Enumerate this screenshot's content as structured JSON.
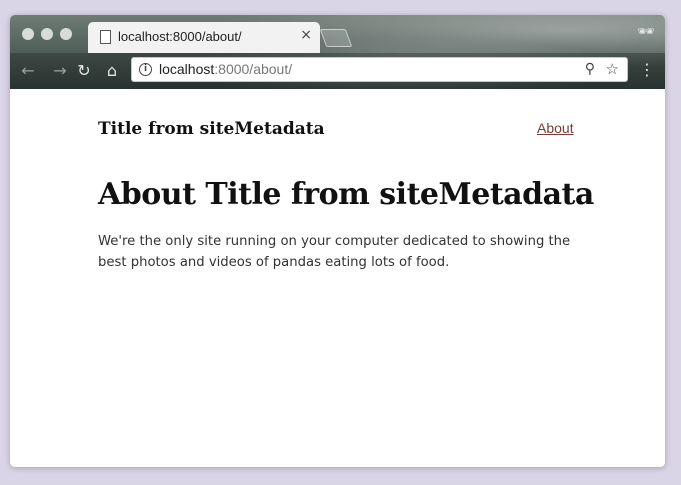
{
  "browser": {
    "tab": {
      "title": "localhost:8000/about/",
      "close_glyph": "×"
    },
    "address_bar": {
      "host": "localhost",
      "rest": ":8000/about/"
    },
    "icons": {
      "back": "←",
      "forward": "→",
      "reload": "↻",
      "home": "⌂",
      "info": "i",
      "zoom": "⚲",
      "star": "☆",
      "menu": "⋮",
      "incognito": "🕶"
    }
  },
  "page": {
    "site_title": "Title from siteMetadata",
    "nav": {
      "about_label": "About"
    },
    "heading": "About Title from siteMetadata",
    "body": "We're the only site running on your computer dedicated to showing the best photos and videos of pandas eating lots of food."
  },
  "colors": {
    "link": "#7a3b36",
    "text": "#111111",
    "body_text": "#333333"
  }
}
